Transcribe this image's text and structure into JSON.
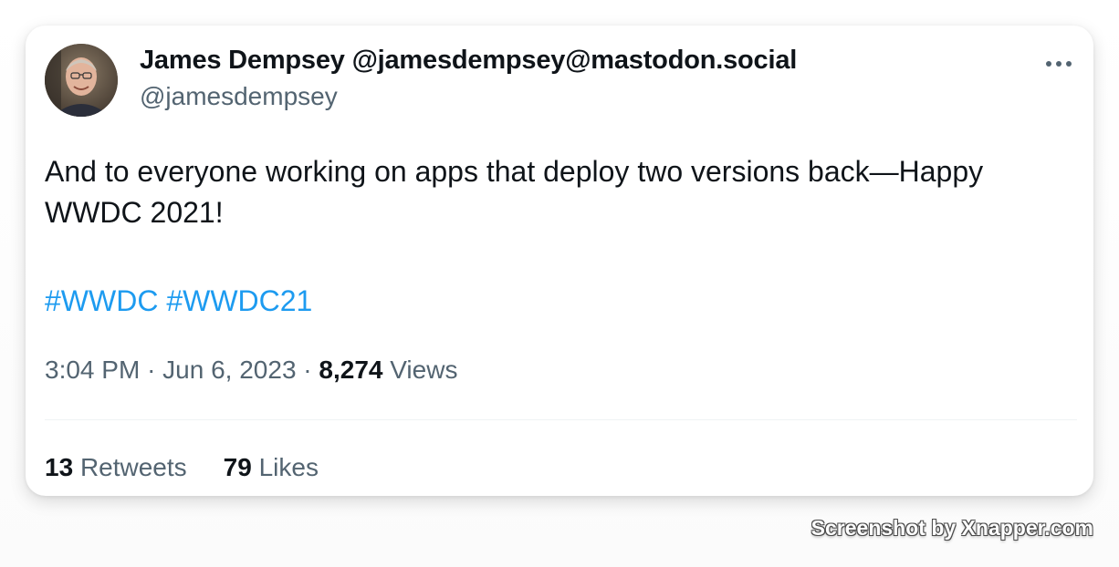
{
  "tweet": {
    "author": {
      "display_name": "James Dempsey @jamesdempsey@mastodon.social",
      "handle": "@jamesdempsey",
      "avatar_icon": "avatar-photo"
    },
    "more_icon": "more-horizontal-icon",
    "text_lines": [
      "And to everyone working on apps that deploy two versions back—Happy",
      "WWDC 2021!"
    ],
    "hashtags": [
      "#WWDC",
      "#WWDC21"
    ],
    "time": "3:04 PM",
    "date": "Jun 6, 2023",
    "separator": "·",
    "views_count": "8,274",
    "views_label": "Views",
    "retweets_count": "13",
    "retweets_label": "Retweets",
    "likes_count": "79",
    "likes_label": "Likes"
  },
  "watermark": "Screenshot by Xnapper.com",
  "colors": {
    "link": "#1d9bf0",
    "primary_text": "#0f1419",
    "secondary_text": "#536471",
    "divider": "#eff3f4"
  }
}
